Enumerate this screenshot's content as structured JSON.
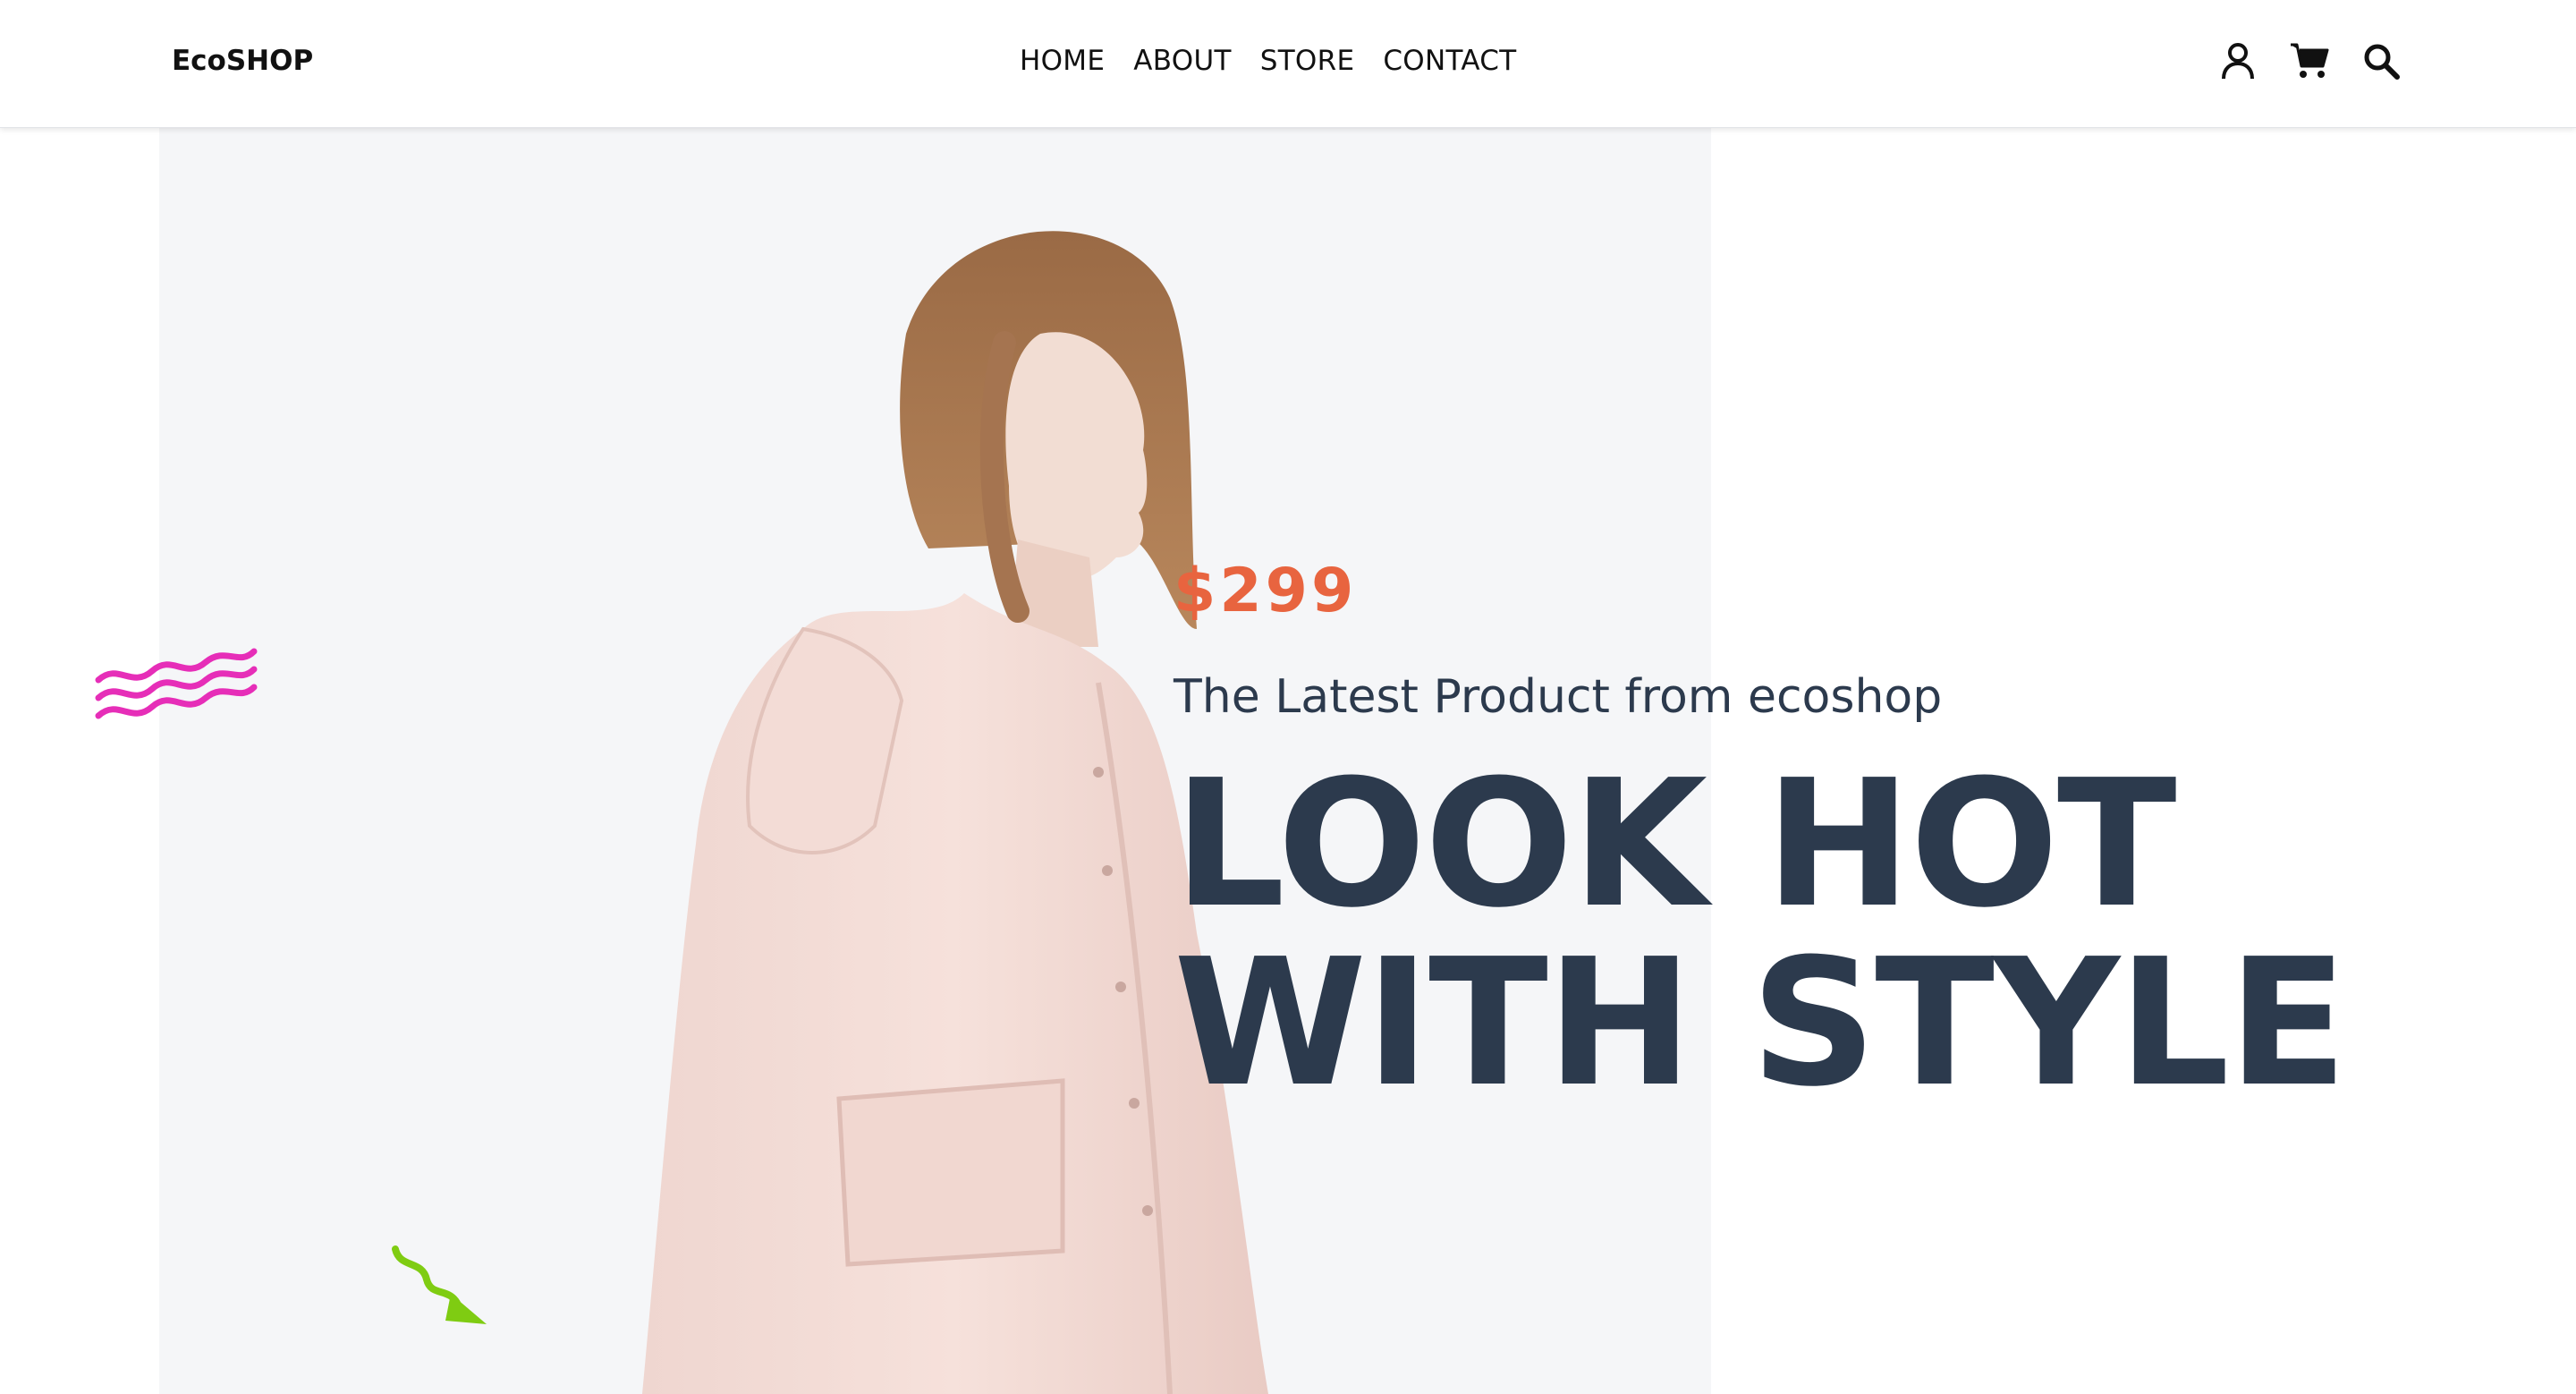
{
  "header": {
    "brand": "EcoSHOP",
    "nav": [
      "HOME",
      "ABOUT",
      "STORE",
      "CONTACT"
    ],
    "icons": [
      "user-icon",
      "cart-icon",
      "search-icon"
    ]
  },
  "hero": {
    "price": "$299",
    "subtitle": "The Latest Product from ecoshop",
    "headline_line1": "LOOK HOT",
    "headline_line2": "WITH STYLE"
  },
  "colors": {
    "accent_price": "#e8643f",
    "headline": "#2c3a4d",
    "squiggle_pink": "#e62eb8",
    "squiggle_green": "#7fcc12",
    "hero_bg": "#f5f6f8"
  }
}
